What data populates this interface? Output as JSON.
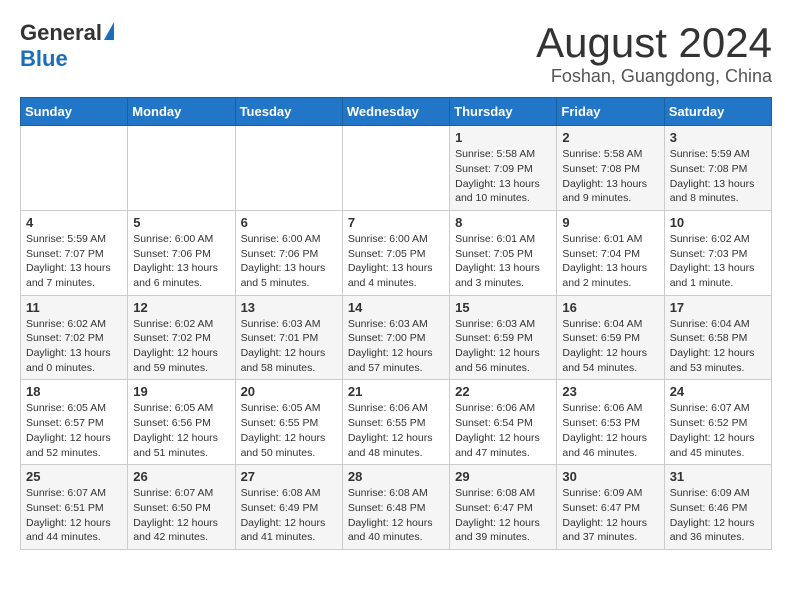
{
  "header": {
    "logo_general": "General",
    "logo_blue": "Blue",
    "month_year": "August 2024",
    "location": "Foshan, Guangdong, China"
  },
  "weekdays": [
    "Sunday",
    "Monday",
    "Tuesday",
    "Wednesday",
    "Thursday",
    "Friday",
    "Saturday"
  ],
  "weeks": [
    [
      {
        "day": "",
        "info": ""
      },
      {
        "day": "",
        "info": ""
      },
      {
        "day": "",
        "info": ""
      },
      {
        "day": "",
        "info": ""
      },
      {
        "day": "1",
        "info": "Sunrise: 5:58 AM\nSunset: 7:09 PM\nDaylight: 13 hours\nand 10 minutes."
      },
      {
        "day": "2",
        "info": "Sunrise: 5:58 AM\nSunset: 7:08 PM\nDaylight: 13 hours\nand 9 minutes."
      },
      {
        "day": "3",
        "info": "Sunrise: 5:59 AM\nSunset: 7:08 PM\nDaylight: 13 hours\nand 8 minutes."
      }
    ],
    [
      {
        "day": "4",
        "info": "Sunrise: 5:59 AM\nSunset: 7:07 PM\nDaylight: 13 hours\nand 7 minutes."
      },
      {
        "day": "5",
        "info": "Sunrise: 6:00 AM\nSunset: 7:06 PM\nDaylight: 13 hours\nand 6 minutes."
      },
      {
        "day": "6",
        "info": "Sunrise: 6:00 AM\nSunset: 7:06 PM\nDaylight: 13 hours\nand 5 minutes."
      },
      {
        "day": "7",
        "info": "Sunrise: 6:00 AM\nSunset: 7:05 PM\nDaylight: 13 hours\nand 4 minutes."
      },
      {
        "day": "8",
        "info": "Sunrise: 6:01 AM\nSunset: 7:05 PM\nDaylight: 13 hours\nand 3 minutes."
      },
      {
        "day": "9",
        "info": "Sunrise: 6:01 AM\nSunset: 7:04 PM\nDaylight: 13 hours\nand 2 minutes."
      },
      {
        "day": "10",
        "info": "Sunrise: 6:02 AM\nSunset: 7:03 PM\nDaylight: 13 hours\nand 1 minute."
      }
    ],
    [
      {
        "day": "11",
        "info": "Sunrise: 6:02 AM\nSunset: 7:02 PM\nDaylight: 13 hours\nand 0 minutes."
      },
      {
        "day": "12",
        "info": "Sunrise: 6:02 AM\nSunset: 7:02 PM\nDaylight: 12 hours\nand 59 minutes."
      },
      {
        "day": "13",
        "info": "Sunrise: 6:03 AM\nSunset: 7:01 PM\nDaylight: 12 hours\nand 58 minutes."
      },
      {
        "day": "14",
        "info": "Sunrise: 6:03 AM\nSunset: 7:00 PM\nDaylight: 12 hours\nand 57 minutes."
      },
      {
        "day": "15",
        "info": "Sunrise: 6:03 AM\nSunset: 6:59 PM\nDaylight: 12 hours\nand 56 minutes."
      },
      {
        "day": "16",
        "info": "Sunrise: 6:04 AM\nSunset: 6:59 PM\nDaylight: 12 hours\nand 54 minutes."
      },
      {
        "day": "17",
        "info": "Sunrise: 6:04 AM\nSunset: 6:58 PM\nDaylight: 12 hours\nand 53 minutes."
      }
    ],
    [
      {
        "day": "18",
        "info": "Sunrise: 6:05 AM\nSunset: 6:57 PM\nDaylight: 12 hours\nand 52 minutes."
      },
      {
        "day": "19",
        "info": "Sunrise: 6:05 AM\nSunset: 6:56 PM\nDaylight: 12 hours\nand 51 minutes."
      },
      {
        "day": "20",
        "info": "Sunrise: 6:05 AM\nSunset: 6:55 PM\nDaylight: 12 hours\nand 50 minutes."
      },
      {
        "day": "21",
        "info": "Sunrise: 6:06 AM\nSunset: 6:55 PM\nDaylight: 12 hours\nand 48 minutes."
      },
      {
        "day": "22",
        "info": "Sunrise: 6:06 AM\nSunset: 6:54 PM\nDaylight: 12 hours\nand 47 minutes."
      },
      {
        "day": "23",
        "info": "Sunrise: 6:06 AM\nSunset: 6:53 PM\nDaylight: 12 hours\nand 46 minutes."
      },
      {
        "day": "24",
        "info": "Sunrise: 6:07 AM\nSunset: 6:52 PM\nDaylight: 12 hours\nand 45 minutes."
      }
    ],
    [
      {
        "day": "25",
        "info": "Sunrise: 6:07 AM\nSunset: 6:51 PM\nDaylight: 12 hours\nand 44 minutes."
      },
      {
        "day": "26",
        "info": "Sunrise: 6:07 AM\nSunset: 6:50 PM\nDaylight: 12 hours\nand 42 minutes."
      },
      {
        "day": "27",
        "info": "Sunrise: 6:08 AM\nSunset: 6:49 PM\nDaylight: 12 hours\nand 41 minutes."
      },
      {
        "day": "28",
        "info": "Sunrise: 6:08 AM\nSunset: 6:48 PM\nDaylight: 12 hours\nand 40 minutes."
      },
      {
        "day": "29",
        "info": "Sunrise: 6:08 AM\nSunset: 6:47 PM\nDaylight: 12 hours\nand 39 minutes."
      },
      {
        "day": "30",
        "info": "Sunrise: 6:09 AM\nSunset: 6:47 PM\nDaylight: 12 hours\nand 37 minutes."
      },
      {
        "day": "31",
        "info": "Sunrise: 6:09 AM\nSunset: 6:46 PM\nDaylight: 12 hours\nand 36 minutes."
      }
    ]
  ]
}
